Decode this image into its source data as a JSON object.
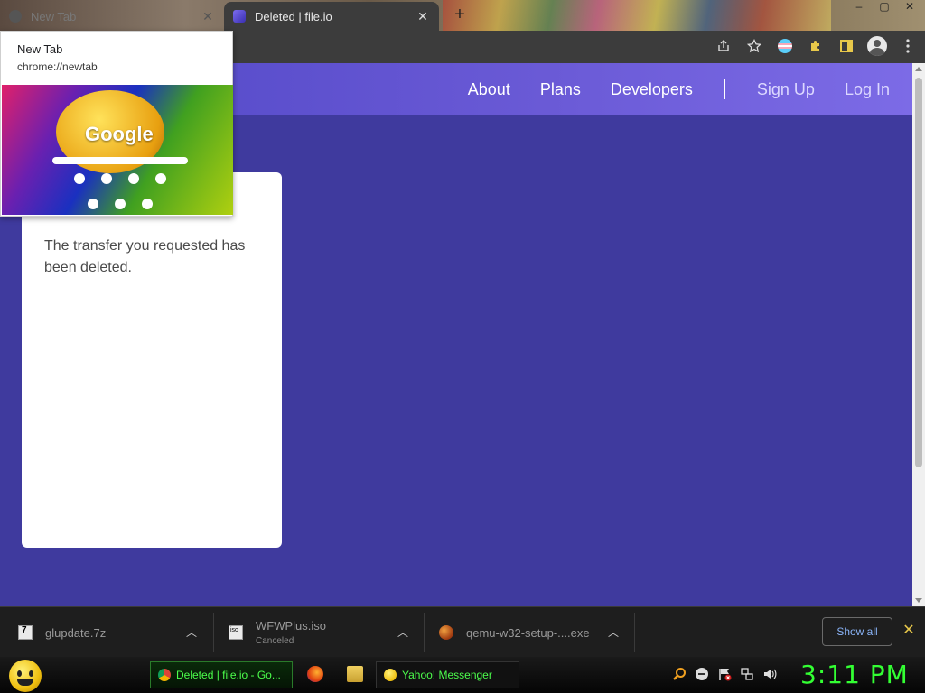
{
  "browser": {
    "tabs": [
      {
        "title": "New Tab",
        "active": false
      },
      {
        "title": "Deleted | file.io",
        "active": true
      }
    ],
    "new_tab_symbol": "+",
    "close_symbol": "✕",
    "window_controls": {
      "minimize": "–",
      "maximize": "▢",
      "close": "✕"
    },
    "toolbar_icons": [
      "share-icon",
      "bookmark-star-icon",
      "trans-flag-extension-icon",
      "extensions-puzzle-icon",
      "side-panel-icon",
      "profile-avatar-icon",
      "menu-kebab-icon"
    ]
  },
  "tab_preview": {
    "title": "New Tab",
    "url": "chrome://newtab",
    "thumbnail_logo": "Google"
  },
  "page": {
    "nav": {
      "about": "About",
      "plans": "Plans",
      "developers": "Developers",
      "sign_up": "Sign Up",
      "log_in": "Log In"
    },
    "message": "The transfer you requested has been deleted.",
    "colors": {
      "background": "#3f3a9e",
      "header": "#6a5ad6",
      "card": "#ffffff"
    }
  },
  "downloads": {
    "items": [
      {
        "name": "glupdate.7z",
        "status": "",
        "icon": "7z-archive-icon"
      },
      {
        "name": "WFWPlus.iso",
        "status": "Canceled",
        "icon": "iso-file-icon"
      },
      {
        "name": "qemu-w32-setup-....exe",
        "status": "",
        "icon": "exe-installer-icon"
      }
    ],
    "show_all": "Show all",
    "close_symbol": "✕"
  },
  "taskbar": {
    "buttons": [
      {
        "label": "Deleted | file.io - Go...",
        "icon": "chrome-icon"
      },
      {
        "label": "Yahoo! Messenger",
        "icon": "yahoo-smiley-icon"
      }
    ],
    "clock": "3:11 PM"
  }
}
